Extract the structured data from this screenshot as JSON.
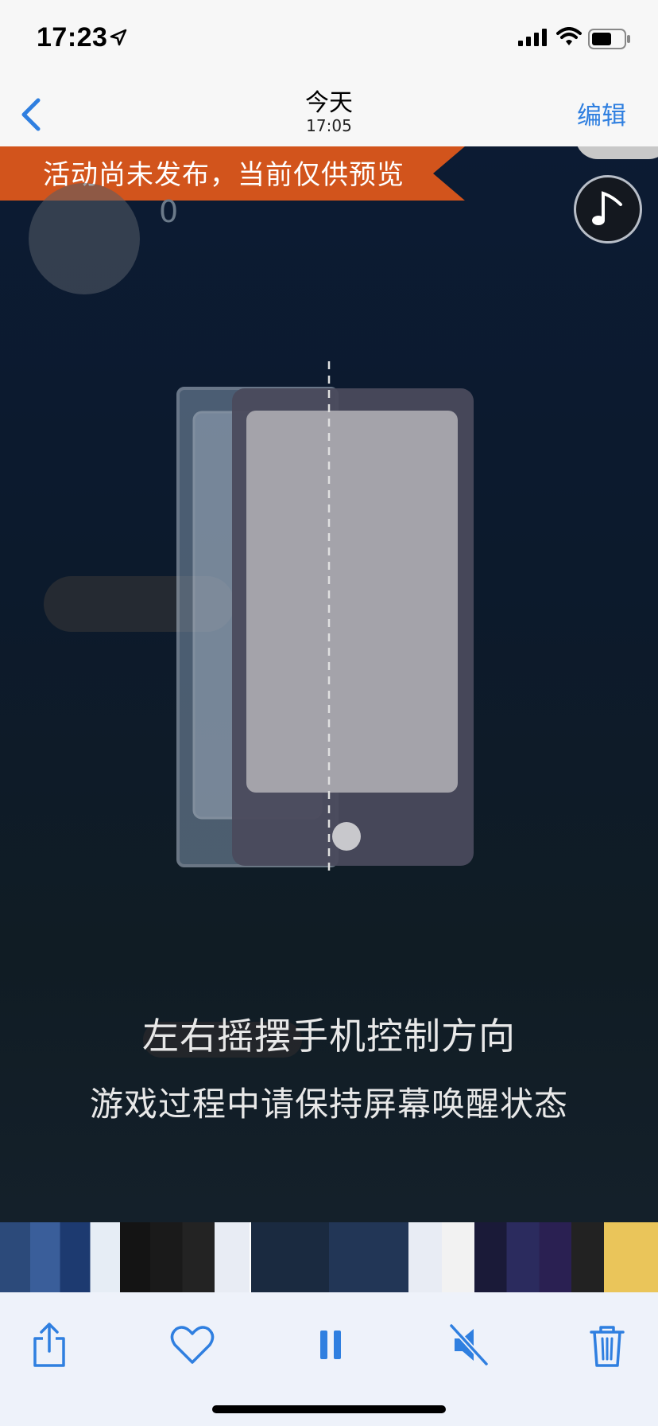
{
  "status_bar": {
    "time": "17:23"
  },
  "nav": {
    "title": "今天",
    "subtitle": "17:05",
    "edit_label": "编辑"
  },
  "game": {
    "banner": "活动尚未发布，当前仅供预览",
    "level_digit": "0",
    "instruction_primary": "左右摇摆手机控制方向",
    "instruction_secondary": "游戏过程中请保持屏幕唤醒状态"
  },
  "toolbar": {
    "icons": [
      "share-icon",
      "heart-icon",
      "pause-icon",
      "mute-icon",
      "trash-icon"
    ]
  },
  "colors": {
    "accent": "#2f7fe0",
    "banner": "#d2541c",
    "background": "#0c1b33"
  }
}
